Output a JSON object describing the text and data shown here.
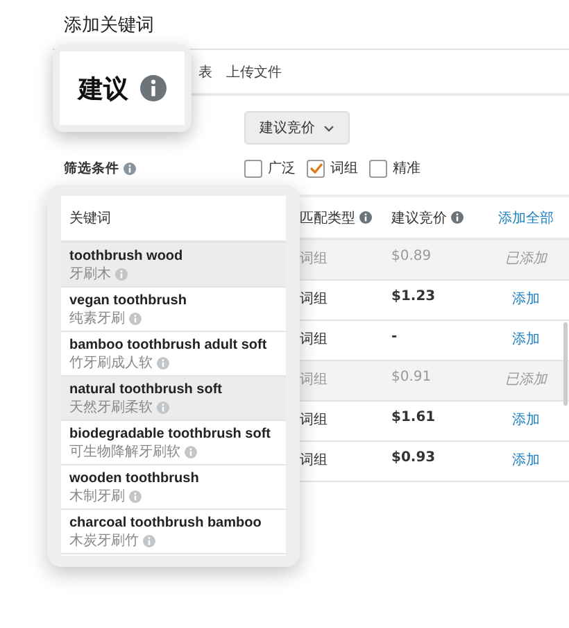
{
  "title": "添加关键词",
  "tab_callout": {
    "label": "建议"
  },
  "tabs": [
    {
      "label": "表"
    },
    {
      "label": "上传文件"
    }
  ],
  "bid_dropdown": {
    "value": "建议竞价"
  },
  "filter": {
    "label": "筛选条件",
    "options": [
      {
        "label": "广泛",
        "checked": false
      },
      {
        "label": "词组",
        "checked": true
      },
      {
        "label": "精准",
        "checked": false
      }
    ]
  },
  "table": {
    "columns": [
      "匹配类型",
      "建议竞价"
    ],
    "add_all": "添加全部",
    "rows": [
      {
        "match": "词组",
        "bid": "$0.89",
        "action": "已添加",
        "added": true
      },
      {
        "match": "词组",
        "bid": "$1.23",
        "action": "添加",
        "added": false
      },
      {
        "match": "词组",
        "bid": "-",
        "action": "添加",
        "added": false
      },
      {
        "match": "词组",
        "bid": "$0.91",
        "action": "已添加",
        "added": true
      },
      {
        "match": "词组",
        "bid": "$1.61",
        "action": "添加",
        "added": false
      },
      {
        "match": "词组",
        "bid": "$0.93",
        "action": "添加",
        "added": false
      }
    ]
  },
  "keyword_callout": {
    "header": "关键词",
    "rows": [
      {
        "keyword": "toothbrush wood",
        "translation": "牙刷木",
        "added": true
      },
      {
        "keyword": "vegan toothbrush",
        "translation": "纯素牙刷",
        "added": false
      },
      {
        "keyword": "bamboo toothbrush adult soft",
        "translation": "竹牙刷成人软",
        "added": false
      },
      {
        "keyword": "natural toothbrush soft",
        "translation": "天然牙刷柔软",
        "added": true
      },
      {
        "keyword": "biodegradable toothbrush soft",
        "translation": "可生物降解牙刷软",
        "added": false
      },
      {
        "keyword": "wooden toothbrush",
        "translation": "木制牙刷",
        "added": false
      },
      {
        "keyword": "charcoal toothbrush bamboo",
        "translation": "木炭牙刷竹",
        "added": false
      }
    ]
  }
}
